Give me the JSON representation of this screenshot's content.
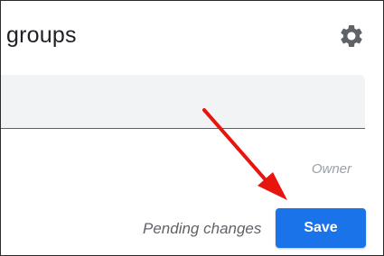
{
  "header": {
    "title": "groups",
    "settings_icon": "gear-icon"
  },
  "form": {
    "input_value": "",
    "column_label": "Owner"
  },
  "footer": {
    "status_text": "Pending changes",
    "save_label": "Save"
  },
  "annotation": {
    "icon": "red-arrow-icon",
    "color": "#e8150e"
  },
  "colors": {
    "accent": "#1a73e8",
    "text": "#202124",
    "muted": "#9aa0a6",
    "field_bg": "#f1f3f4"
  }
}
